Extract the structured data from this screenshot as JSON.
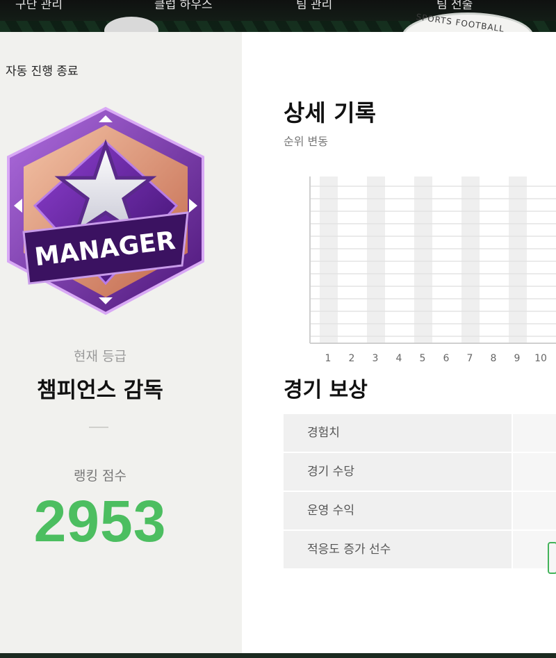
{
  "topnav": {
    "tabs": [
      "구단 관리",
      "클럽 하우스",
      "팀 관리",
      "팀 전술"
    ]
  },
  "left": {
    "auto_end": "자동 진행 종료",
    "badge_text": "MANAGER",
    "grade_label": "현재 등급",
    "grade_name": "챔피언스 감독",
    "rank_label": "랭킹 점수",
    "rank_score": "2953"
  },
  "right": {
    "detail_title": "상세 기록",
    "rank_change_label": "순위 변동",
    "reward_title": "경기 보상",
    "rewards": [
      {
        "name": "경험치"
      },
      {
        "name": "경기 수당"
      },
      {
        "name": "운영 수익"
      },
      {
        "name": "적응도 증가 선수"
      }
    ]
  },
  "chart_data": {
    "type": "bar",
    "categories": [
      "1",
      "2",
      "3",
      "4",
      "5",
      "6",
      "7",
      "8",
      "9",
      "10"
    ],
    "values": [],
    "title": "순위 변동",
    "xlabel": "",
    "ylabel": "",
    "grid": true
  },
  "colors": {
    "score_green": "#4cbe60",
    "badge_purple": "#7a2fb0"
  }
}
